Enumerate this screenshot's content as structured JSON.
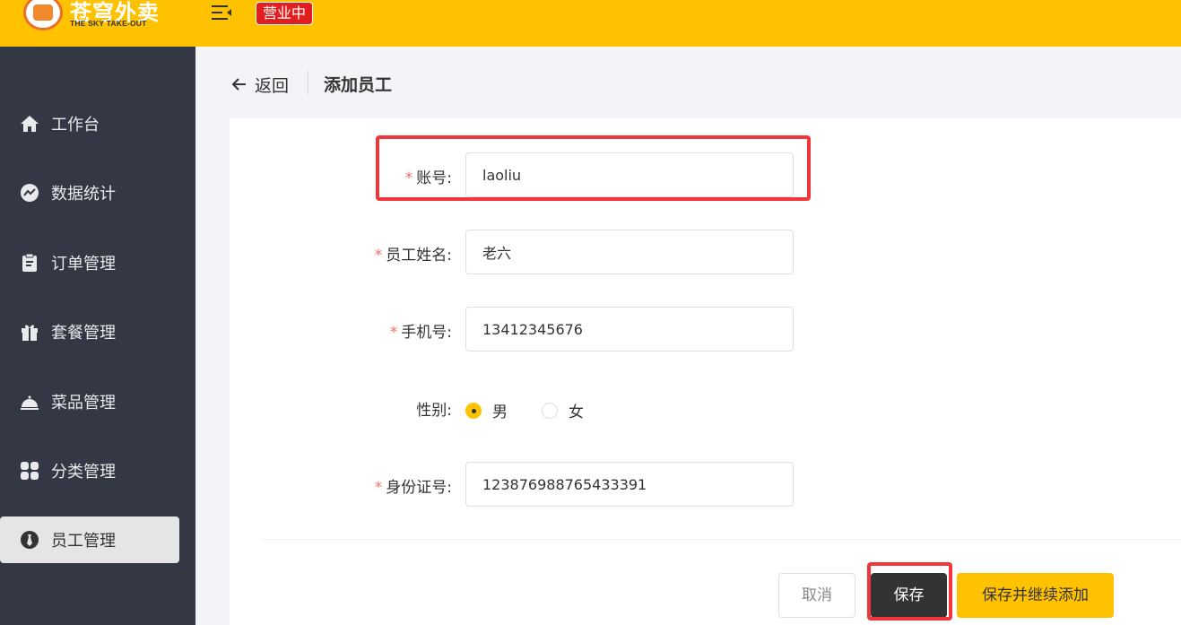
{
  "header": {
    "logo_cn": "苍穹外卖",
    "logo_en": "THE SKY TAKE-OUT",
    "status_badge": "营业中",
    "brand_color": "#ffc200"
  },
  "sidebar": {
    "items": [
      {
        "label": "工作台",
        "icon": "home-icon"
      },
      {
        "label": "数据统计",
        "icon": "chart-icon"
      },
      {
        "label": "订单管理",
        "icon": "clipboard-icon"
      },
      {
        "label": "套餐管理",
        "icon": "gift-icon"
      },
      {
        "label": "菜品管理",
        "icon": "cloche-icon"
      },
      {
        "label": "分类管理",
        "icon": "grid-icon"
      },
      {
        "label": "员工管理",
        "icon": "employee-icon",
        "active": true
      }
    ]
  },
  "page": {
    "back_label": "返回",
    "title": "添加员工"
  },
  "form": {
    "account_label": "账号:",
    "account_value": "laoliu",
    "name_label": "员工姓名:",
    "name_value": "老六",
    "phone_label": "手机号:",
    "phone_value": "13412345676",
    "gender_label": "性别:",
    "gender_options": [
      "男",
      "女"
    ],
    "gender_selected": "男",
    "idcard_label": "身份证号:",
    "idcard_value": "123876988765433391"
  },
  "buttons": {
    "cancel": "取消",
    "save": "保存",
    "save_continue": "保存并继续添加"
  },
  "colors": {
    "accent": "#ffc200",
    "sidebar_bg": "#343744",
    "highlight": "#f0353b",
    "required_star": "#f56c6c"
  }
}
